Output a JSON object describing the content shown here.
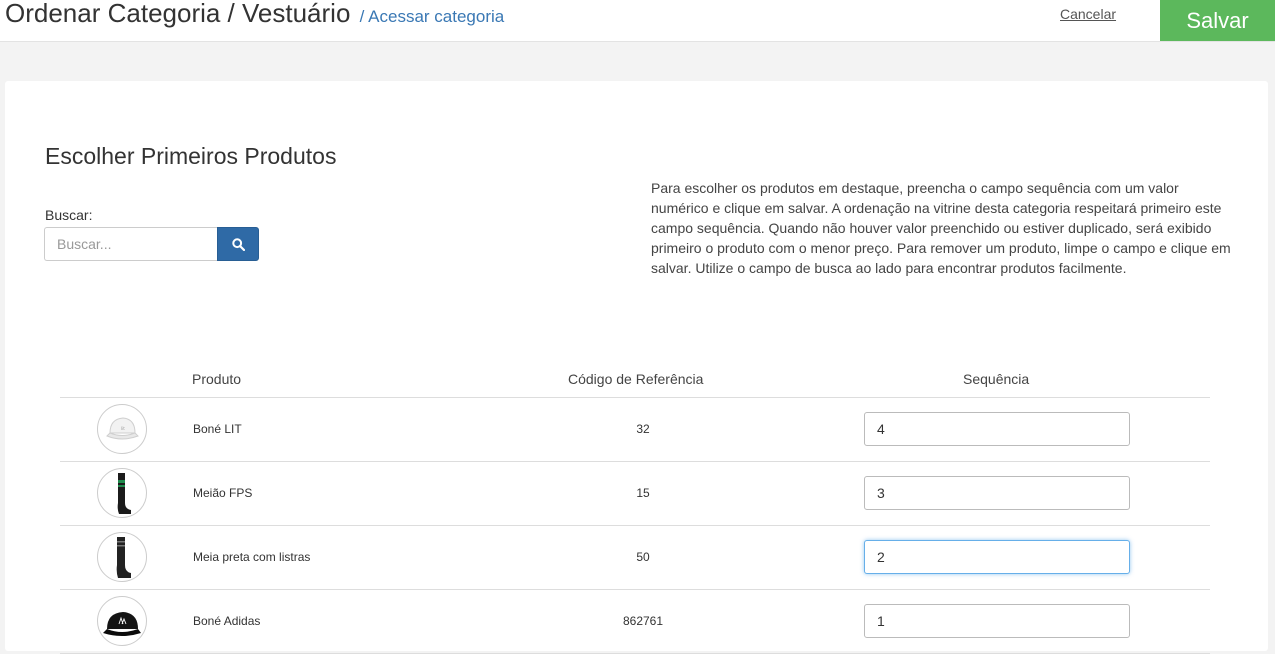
{
  "header": {
    "title": "Ordenar Categoria / Vestuário",
    "breadcrumb_link": "/ Acessar categoria",
    "cancel_label": "Cancelar",
    "save_label": "Salvar"
  },
  "section": {
    "title": "Escolher Primeiros Produtos",
    "search_label": "Buscar:",
    "search_placeholder": "Buscar...",
    "help_text": "Para escolher os produtos em destaque, preencha o campo sequência com um valor numérico e clique em salvar. A ordenação na vitrine desta categoria respeitará primeiro este campo sequência. Quando não houver valor preenchido ou estiver duplicado, será exibido primeiro o produto com o menor preço. Para remover um produto, limpe o campo e clique em salvar. Utilize o campo de busca ao lado para encontrar produtos facilmente."
  },
  "table": {
    "columns": {
      "produto": "Produto",
      "codigo": "Código de Referência",
      "sequencia": "Sequência"
    },
    "rows": [
      {
        "name": "Boné LIT",
        "code": "32",
        "sequence": "4",
        "thumb": "white-cap"
      },
      {
        "name": "Meião FPS",
        "code": "15",
        "sequence": "3",
        "thumb": "black-green-sock"
      },
      {
        "name": "Meia preta com listras",
        "code": "50",
        "sequence": "2",
        "thumb": "black-striped-sock"
      },
      {
        "name": "Boné Adidas",
        "code": "862761",
        "sequence": "1",
        "thumb": "black-cap"
      }
    ]
  },
  "colors": {
    "save_button": "#5cb85c",
    "search_button": "#2f6aa6",
    "link": "#3a78b4",
    "focus_border": "#66afe9"
  },
  "icons": {
    "search_button": "search-icon"
  }
}
